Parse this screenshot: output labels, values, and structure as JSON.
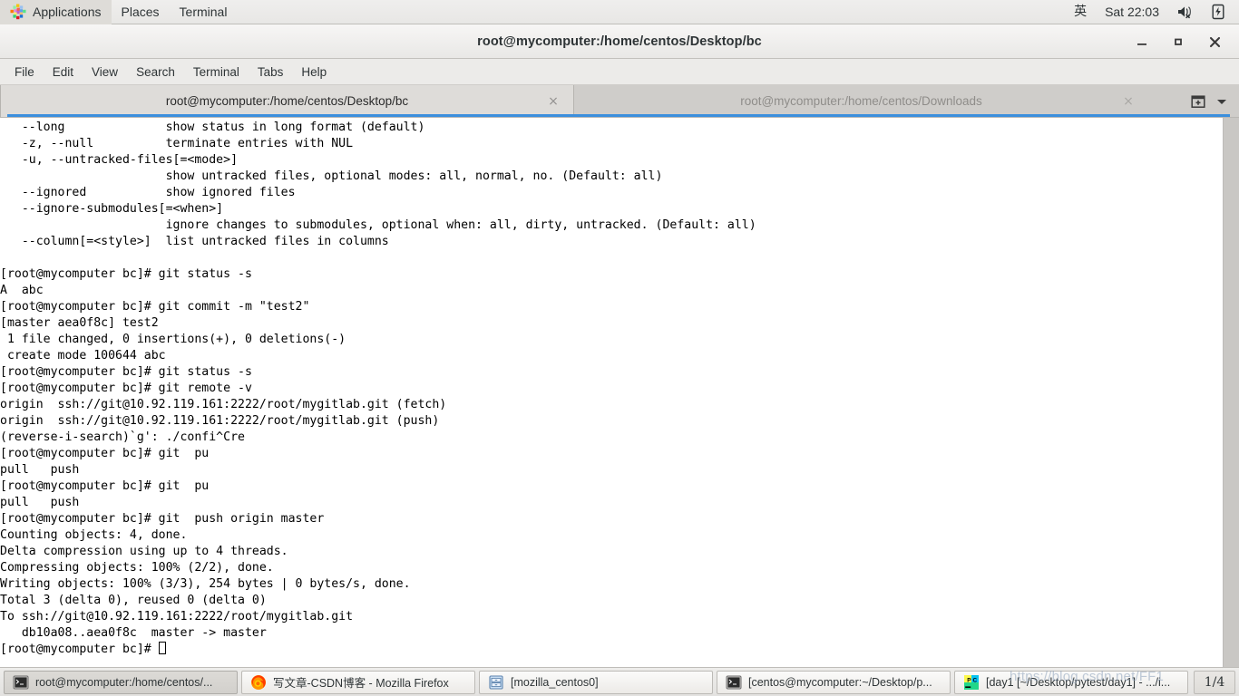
{
  "top_panel": {
    "applications_label": "Applications",
    "places_label": "Places",
    "terminal_label": "Terminal",
    "ime_label": "英",
    "clock": "Sat 22:03",
    "volume_icon": "speaker-muted-icon",
    "battery_icon": "battery-charging-icon"
  },
  "window": {
    "title": "root@mycomputer:/home/centos/Desktop/bc",
    "minimize_label": "minimize",
    "maximize_label": "maximize",
    "close_label": "close"
  },
  "menubar": {
    "items": [
      {
        "label": "File"
      },
      {
        "label": "Edit"
      },
      {
        "label": "View"
      },
      {
        "label": "Search"
      },
      {
        "label": "Terminal"
      },
      {
        "label": "Tabs"
      },
      {
        "label": "Help"
      }
    ]
  },
  "tabbar": {
    "tabs": [
      {
        "label": "root@mycomputer:/home/centos/Desktop/bc",
        "active": true,
        "close": "×"
      },
      {
        "label": "root@mycomputer:/home/centos/Downloads",
        "active": false,
        "close": "×"
      }
    ],
    "new_tab_icon": "new-tab-icon",
    "tab_menu_icon": "chevron-down-icon",
    "accent_color": "#3b8fdd"
  },
  "terminal": {
    "background": "#ffffff",
    "foreground": "#000000",
    "lines": [
      "   --long              show status in long format (default)",
      "   -z, --null          terminate entries with NUL",
      "   -u, --untracked-files[=<mode>]",
      "                       show untracked files, optional modes: all, normal, no. (Default: all)",
      "   --ignored           show ignored files",
      "   --ignore-submodules[=<when>]",
      "                       ignore changes to submodules, optional when: all, dirty, untracked. (Default: all)",
      "   --column[=<style>]  list untracked files in columns",
      "",
      "[root@mycomputer bc]# git status -s",
      "A  abc",
      "[root@mycomputer bc]# git commit -m \"test2\"",
      "[master aea0f8c] test2",
      " 1 file changed, 0 insertions(+), 0 deletions(-)",
      " create mode 100644 abc",
      "[root@mycomputer bc]# git status -s",
      "[root@mycomputer bc]# git remote -v",
      "origin  ssh://git@10.92.119.161:2222/root/mygitlab.git (fetch)",
      "origin  ssh://git@10.92.119.161:2222/root/mygitlab.git (push)",
      "(reverse-i-search)`g': ./confi^Cre",
      "[root@mycomputer bc]# git  pu",
      "pull   push",
      "[root@mycomputer bc]# git  pu",
      "pull   push",
      "[root@mycomputer bc]# git  push origin master",
      "Counting objects: 4, done.",
      "Delta compression using up to 4 threads.",
      "Compressing objects: 100% (2/2), done.",
      "Writing objects: 100% (3/3), 254 bytes | 0 bytes/s, done.",
      "Total 3 (delta 0), reused 0 (delta 0)",
      "To ssh://git@10.92.119.161:2222/root/mygitlab.git",
      "   db10a08..aea0f8c  master -> master"
    ],
    "prompt": "[root@mycomputer bc]# ",
    "cursor": "block-cursor"
  },
  "taskbar": {
    "items": [
      {
        "label": "root@mycomputer:/home/centos/...",
        "icon": "terminal-icon",
        "active": true
      },
      {
        "label": "写文章-CSDN博客 - Mozilla Firefox",
        "icon": "firefox-icon",
        "active": false
      },
      {
        "label": "[mozilla_centos0]",
        "icon": "file-manager-icon",
        "active": false
      },
      {
        "label": "[centos@mycomputer:~/Desktop/p...",
        "icon": "terminal-icon",
        "active": false
      },
      {
        "label": "[day1 [~/Desktop/pytest/day1] - .../i...",
        "icon": "pycharm-icon",
        "active": false
      }
    ],
    "workspace": "1/4"
  },
  "watermark": {
    "text": "https://blog.csdn.net/FF1"
  }
}
